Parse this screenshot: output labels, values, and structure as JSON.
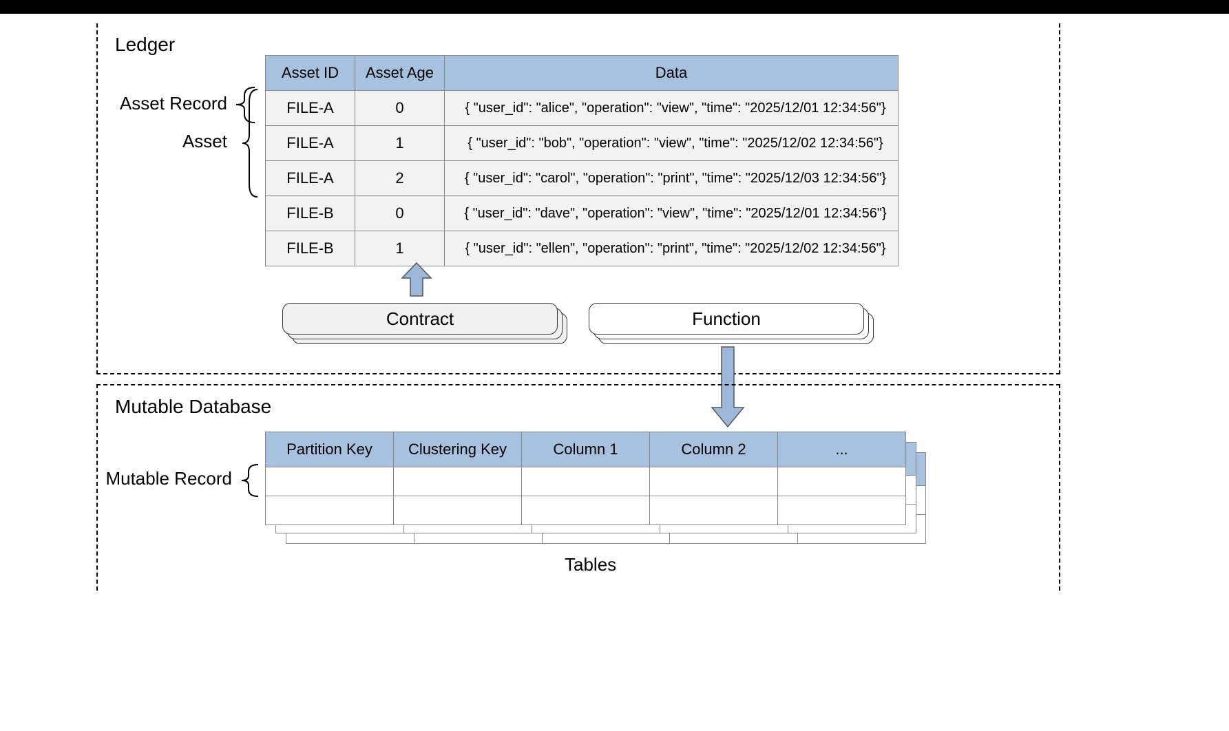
{
  "sections": {
    "ledger_title": "Ledger",
    "mutable_title": "Mutable Database"
  },
  "labels": {
    "asset_record": "Asset Record",
    "asset": "Asset",
    "mutable_record": "Mutable Record",
    "tables": "Tables"
  },
  "ledger_table": {
    "headers": {
      "asset_id": "Asset ID",
      "asset_age": "Asset Age",
      "data": "Data"
    },
    "rows": [
      {
        "asset_id": "FILE-A",
        "asset_age": "0",
        "data": "{ \"user_id\": \"alice\", \"operation\": \"view\", \"time\": \"2025/12/01 12:34:56\"}"
      },
      {
        "asset_id": "FILE-A",
        "asset_age": "1",
        "data": "{ \"user_id\": \"bob\", \"operation\": \"view\", \"time\": \"2025/12/02 12:34:56\"}"
      },
      {
        "asset_id": "FILE-A",
        "asset_age": "2",
        "data": "{ \"user_id\": \"carol\", \"operation\": \"print\", \"time\": \"2025/12/03 12:34:56\"}"
      },
      {
        "asset_id": "FILE-B",
        "asset_age": "0",
        "data": "{ \"user_id\": \"dave\", \"operation\": \"view\", \"time\": \"2025/12/01 12:34:56\"}"
      },
      {
        "asset_id": "FILE-B",
        "asset_age": "1",
        "data": "{ \"user_id\": \"ellen\", \"operation\": \"print\", \"time\": \"2025/12/02 12:34:56\"}"
      }
    ]
  },
  "boxes": {
    "contract": "Contract",
    "function": "Function"
  },
  "mutable_table": {
    "headers": [
      "Partition Key",
      "Clustering Key",
      "Column 1",
      "Column 2",
      "..."
    ]
  },
  "colors": {
    "header_bg": "#a7c1de",
    "row_bg": "#f2f2f2",
    "arrow_fill": "#9db8d8"
  }
}
